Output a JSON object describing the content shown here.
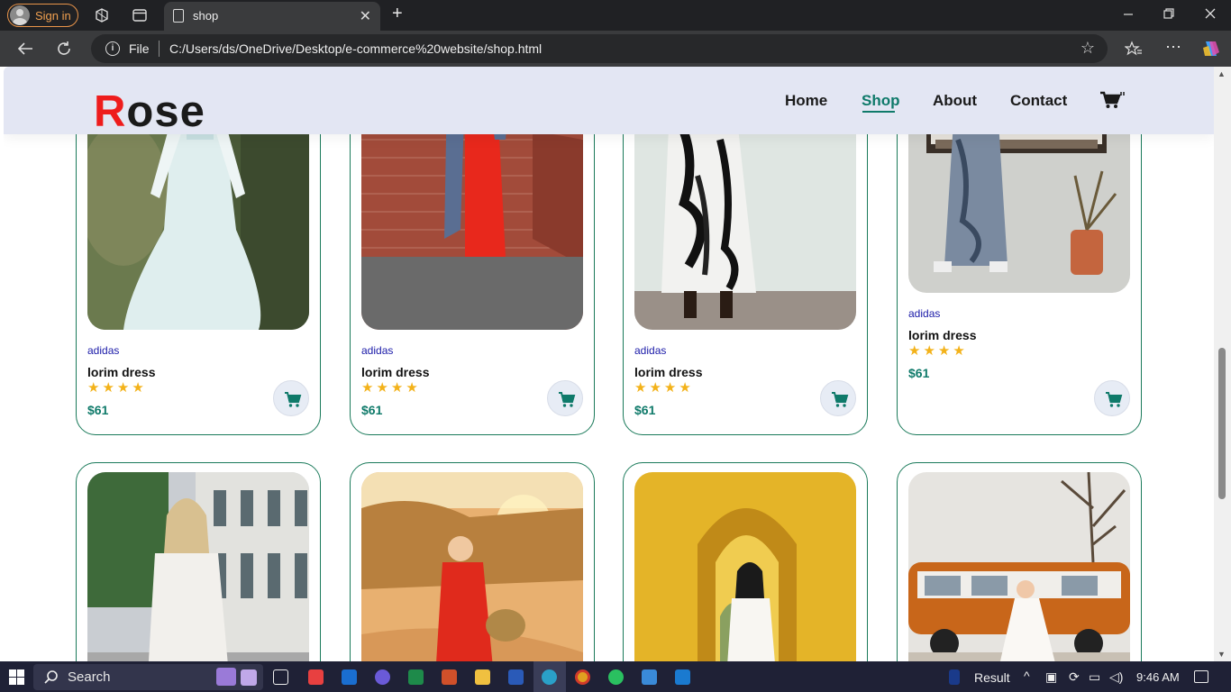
{
  "browser": {
    "sign_in_label": "Sign in",
    "tab_title": "shop",
    "address_scheme": "File",
    "url": "C:/Users/ds/OneDrive/Desktop/e-commerce%20website/shop.html"
  },
  "site": {
    "logo_first_letter": "R",
    "logo_rest": "ose",
    "nav": [
      {
        "label": "Home"
      },
      {
        "label": "Shop",
        "active": true
      },
      {
        "label": "About"
      },
      {
        "label": "Contact"
      }
    ],
    "cart_icon": "cart-icon"
  },
  "products": [
    {
      "brand": "adidas",
      "name": "lorim dress",
      "stars": "★★★★",
      "rating": 4,
      "price": "$61"
    },
    {
      "brand": "adidas",
      "name": "lorim dress",
      "stars": "★★★★",
      "rating": 4,
      "price": "$61"
    },
    {
      "brand": "adidas",
      "name": "lorim dress",
      "stars": "★★★★",
      "rating": 4,
      "price": "$61"
    },
    {
      "brand": "adidas",
      "name": "lorim dress",
      "stars": "★★★★",
      "rating": 4,
      "price": "$61"
    }
  ],
  "taskbar": {
    "search_label": "Search",
    "result_label": "Result",
    "time": "9:46 AM"
  },
  "colors": {
    "accent": "#0f7a6a",
    "logo_red": "#ee1c1c",
    "header_bg": "#e3e6f3",
    "star": "#f3b21a",
    "brand_text": "#1a1aa8"
  }
}
